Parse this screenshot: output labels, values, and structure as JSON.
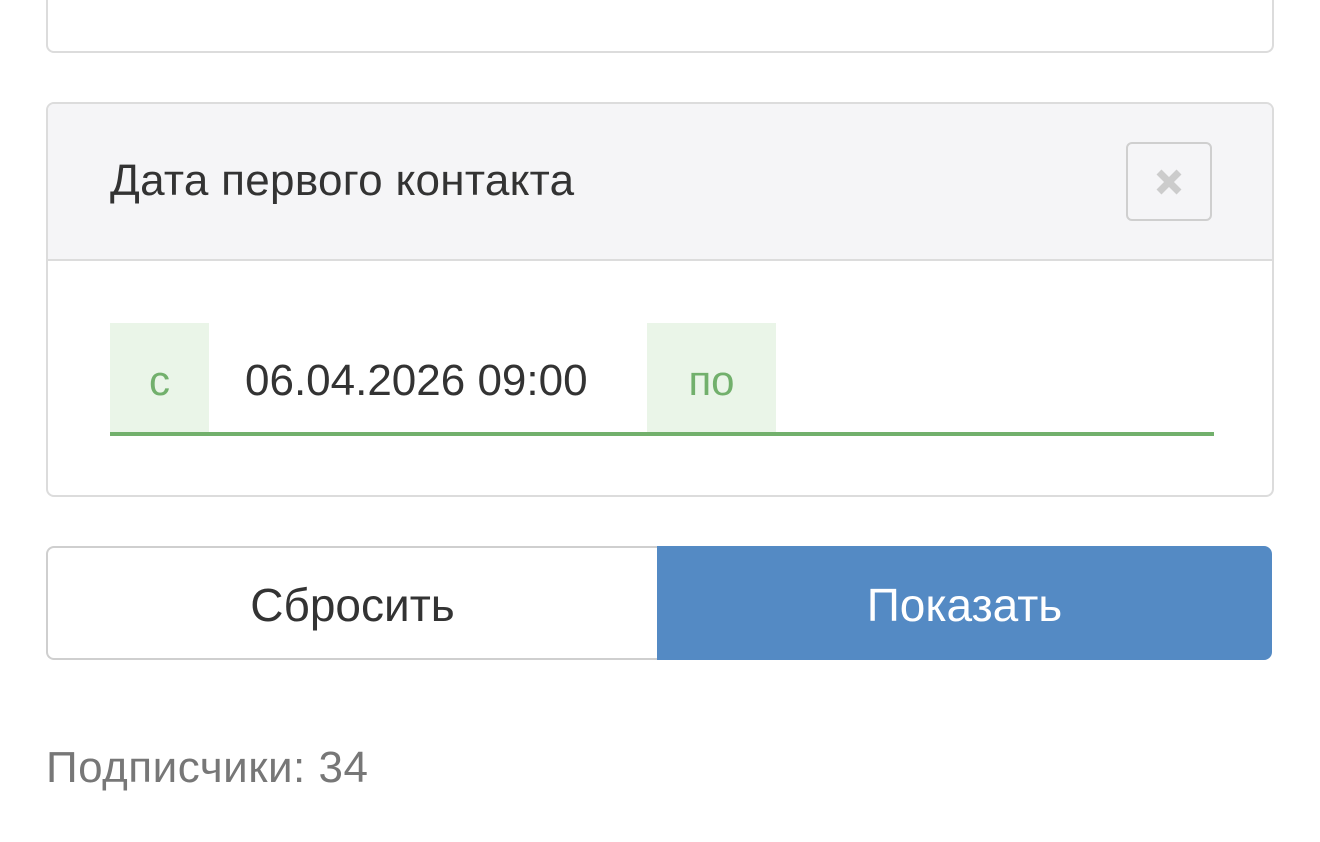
{
  "filter": {
    "title": "Дата первого контакта",
    "from_label": "с",
    "from_value": "06.04.2026 09:00",
    "to_label": "по",
    "to_value": "",
    "close_icon": "close-icon"
  },
  "actions": {
    "reset_label": "Сбросить",
    "show_label": "Показать"
  },
  "summary": {
    "subscribers_text": "Подписчики: 34"
  },
  "colors": {
    "accent_green": "#72b06c",
    "addon_bg": "#eaf5e8",
    "primary_blue": "#548ac4",
    "header_bg": "#f5f5f7"
  }
}
